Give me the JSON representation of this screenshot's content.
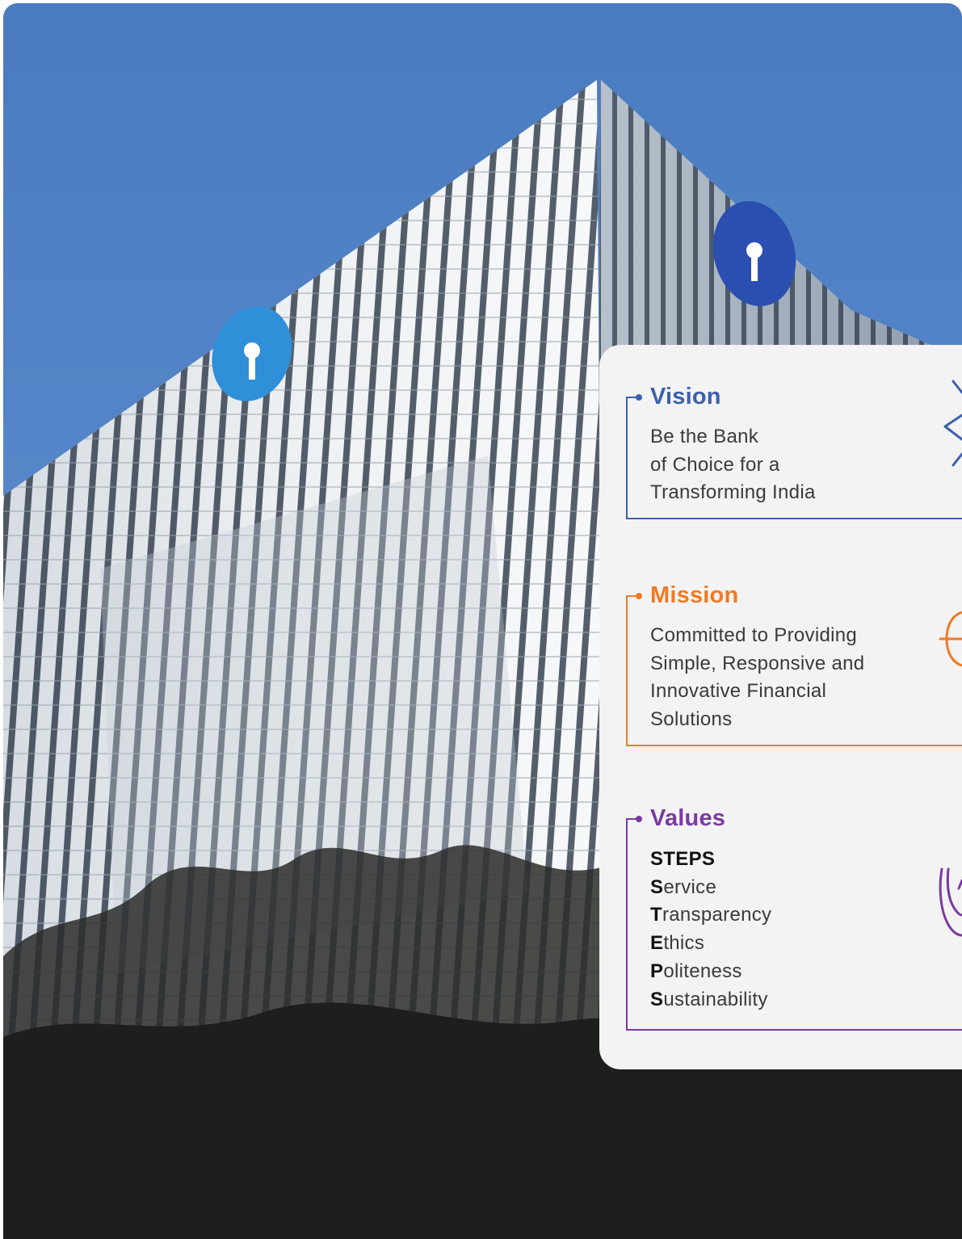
{
  "vision": {
    "title": "Vision",
    "lines": [
      "Be the Bank",
      "of Choice for a",
      "Transforming India"
    ]
  },
  "mission": {
    "title": "Mission",
    "lines": [
      "Committed to Providing",
      "Simple, Responsive and",
      "Innovative Financial",
      "Solutions"
    ]
  },
  "values": {
    "title": "Values",
    "acronym": "STEPS",
    "items": [
      {
        "initial": "S",
        "rest": "ervice"
      },
      {
        "initial": "T",
        "rest": "ransparency"
      },
      {
        "initial": "E",
        "rest": "thics"
      },
      {
        "initial": "P",
        "rest": "oliteness"
      },
      {
        "initial": "S",
        "rest": "ustainability"
      }
    ]
  },
  "colors": {
    "vision": "#3c5fae",
    "mission": "#f07a24",
    "values": "#7a3aa3",
    "card_bg": "#f3f3f3",
    "sky": "#4c7fc2"
  },
  "icons": {
    "vision": "compass-icon",
    "mission": "target-icon",
    "values": "hand-icon"
  }
}
